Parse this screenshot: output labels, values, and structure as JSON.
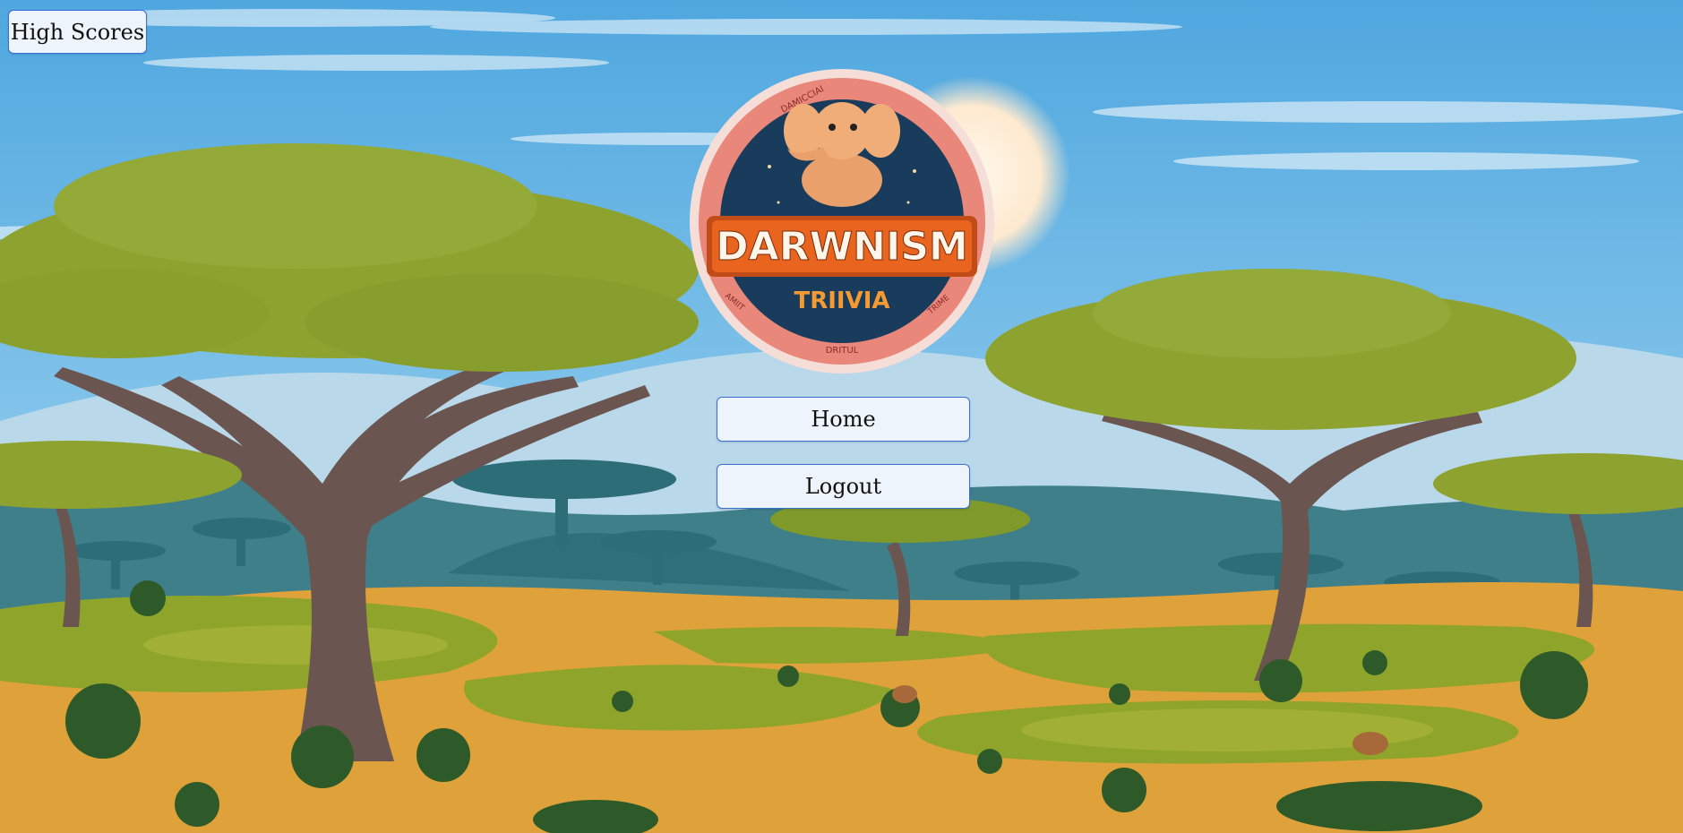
{
  "menu": {
    "high_scores_label": "High Scores",
    "home_label": "Home",
    "logout_label": "Logout"
  },
  "logo": {
    "title": "DARWNISM",
    "subtitle": "TRIIVIA",
    "ring_top": "DAMICCIAI",
    "ring_left": "AMIIT",
    "ring_right": "TRIME",
    "ring_bottom": "DRITUL"
  },
  "colors": {
    "sky_top": "#5fb0e3",
    "sky_bottom": "#cfe9f6",
    "ground": "#e0a43a",
    "grass": "#8fa62a",
    "button_bg": "#eef4fc",
    "button_border": "#3b6fd8",
    "logo_banner": "#e8641f",
    "logo_inner": "#1a3c5c"
  }
}
